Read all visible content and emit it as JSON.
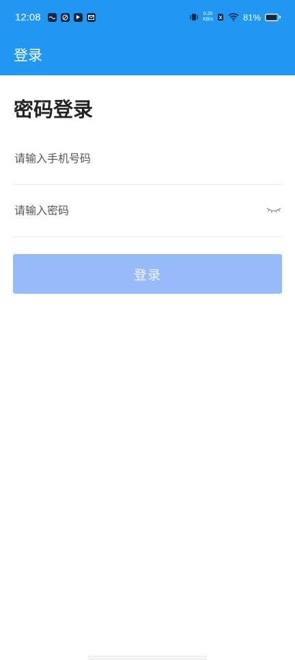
{
  "status_bar": {
    "time": "12:08",
    "net_speed_value": "0.20",
    "net_speed_unit": "KB/s",
    "battery_percent": "81%",
    "battery_level": 0.81,
    "icons": [
      "notification-app-icon",
      "notification-app-icon",
      "notification-app-icon",
      "mail-icon",
      "vibrate-icon",
      "sim-off-icon",
      "wifi-icon",
      "battery-icon"
    ]
  },
  "app_bar": {
    "title": "登录"
  },
  "page": {
    "heading": "密码登录"
  },
  "form": {
    "phone_placeholder": "请输入手机号码",
    "password_placeholder": "请输入密码",
    "password_toggle_icon": "eye-closed-icon",
    "login_label": "登录"
  },
  "colors": {
    "primary": "#2196f3",
    "button_disabled": "#97bbf8",
    "divider": "#ebebeb"
  }
}
